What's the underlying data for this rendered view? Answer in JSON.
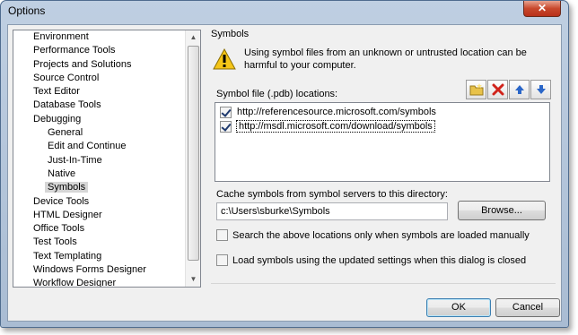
{
  "window": {
    "title": "Options",
    "close_glyph": "✕"
  },
  "tree": {
    "items": [
      {
        "label": "Environment",
        "level": 0
      },
      {
        "label": "Performance Tools",
        "level": 0
      },
      {
        "label": "Projects and Solutions",
        "level": 0
      },
      {
        "label": "Source Control",
        "level": 0
      },
      {
        "label": "Text Editor",
        "level": 0
      },
      {
        "label": "Database Tools",
        "level": 0
      },
      {
        "label": "Debugging",
        "level": 0
      },
      {
        "label": "General",
        "level": 1
      },
      {
        "label": "Edit and Continue",
        "level": 1
      },
      {
        "label": "Just-In-Time",
        "level": 1
      },
      {
        "label": "Native",
        "level": 1
      },
      {
        "label": "Symbols",
        "level": 1,
        "selected": true
      },
      {
        "label": "Device Tools",
        "level": 0
      },
      {
        "label": "HTML Designer",
        "level": 0
      },
      {
        "label": "Office Tools",
        "level": 0
      },
      {
        "label": "Test Tools",
        "level": 0
      },
      {
        "label": "Text Templating",
        "level": 0
      },
      {
        "label": "Windows Forms Designer",
        "level": 0
      },
      {
        "label": "Workflow Designer",
        "level": 0
      }
    ]
  },
  "panel": {
    "section_title": "Symbols",
    "warning_text": "Using symbol files from an unknown or untrusted location can be harmful to your computer.",
    "pdb_label": "Symbol file (.pdb) locations:",
    "locations": [
      {
        "url": "http://referencesource.microsoft.com/symbols",
        "checked": true
      },
      {
        "url": "http://msdl.microsoft.com/download/symbols",
        "checked": true,
        "focused": true
      }
    ],
    "cache_label": "Cache symbols from symbol servers to this directory:",
    "cache_value": "c:\\Users\\sburke\\Symbols",
    "browse_label": "Browse...",
    "option_manual": {
      "label": "Search the above locations only when symbols are loaded manually",
      "checked": false
    },
    "option_updated": {
      "label": "Load symbols using the updated settings when this dialog is closed",
      "checked": false
    }
  },
  "footer": {
    "ok_label": "OK",
    "cancel_label": "Cancel"
  },
  "colors": {
    "warning_yellow": "#f5c518",
    "delete_red": "#d0231b",
    "arrow_blue": "#2a66c8",
    "folder_yellow": "#e8c24a"
  },
  "icons": [
    "warning-icon",
    "new-folder-icon",
    "delete-icon",
    "move-up-icon",
    "move-down-icon",
    "close-icon"
  ]
}
